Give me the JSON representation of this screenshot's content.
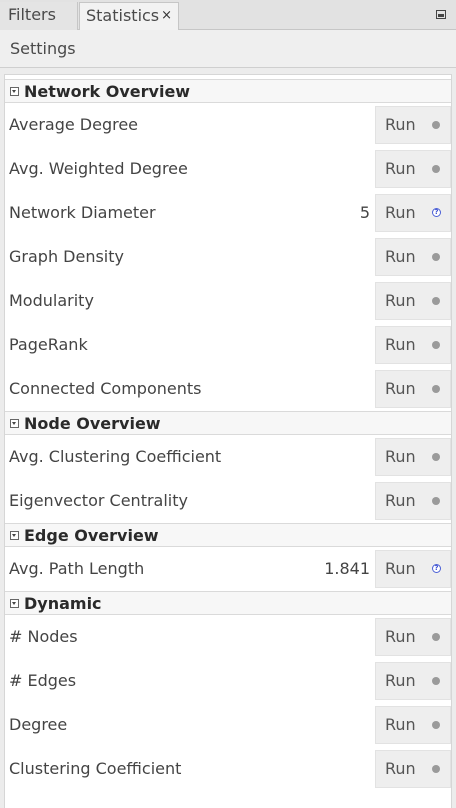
{
  "tabs": {
    "filters": "Filters",
    "statistics": "Statistics",
    "close_glyph": "×"
  },
  "toolbar": {
    "settings": "Settings"
  },
  "run_label": "Run",
  "help_glyph": "?",
  "sections": {
    "network_overview": {
      "title": "Network Overview",
      "rows": [
        {
          "label": "Average Degree",
          "value": ""
        },
        {
          "label": "Avg. Weighted Degree",
          "value": ""
        },
        {
          "label": "Network Diameter",
          "value": "5"
        },
        {
          "label": "Graph Density",
          "value": ""
        },
        {
          "label": "Modularity",
          "value": ""
        },
        {
          "label": "PageRank",
          "value": ""
        },
        {
          "label": "Connected Components",
          "value": ""
        }
      ]
    },
    "node_overview": {
      "title": "Node Overview",
      "rows": [
        {
          "label": "Avg. Clustering Coefficient",
          "value": ""
        },
        {
          "label": "Eigenvector Centrality",
          "value": ""
        }
      ]
    },
    "edge_overview": {
      "title": "Edge Overview",
      "rows": [
        {
          "label": "Avg. Path Length",
          "value": "1.841"
        }
      ]
    },
    "dynamic": {
      "title": "Dynamic",
      "rows": [
        {
          "label": "# Nodes",
          "value": ""
        },
        {
          "label": "# Edges",
          "value": ""
        },
        {
          "label": "Degree",
          "value": ""
        },
        {
          "label": "Clustering Coefficient",
          "value": ""
        }
      ]
    }
  },
  "colors": {
    "status_idle": "#9a9a9a",
    "help_icon": "#3b4fd0"
  }
}
